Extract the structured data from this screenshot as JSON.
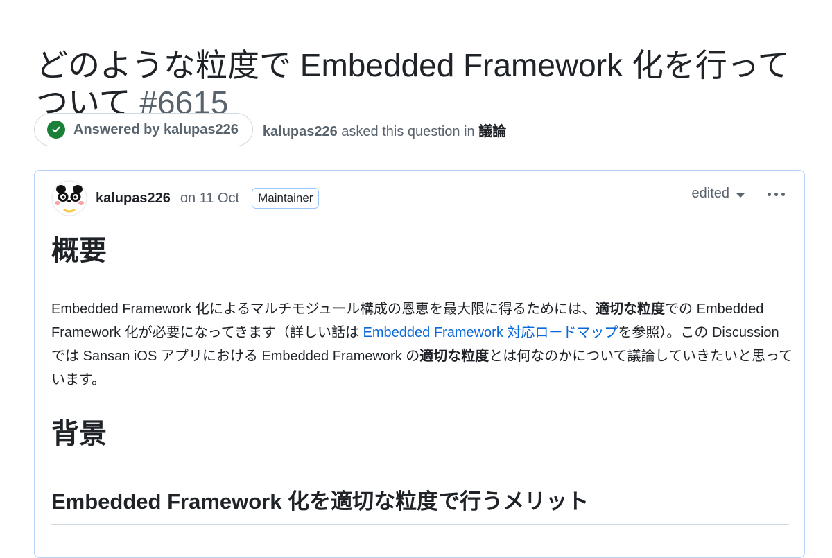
{
  "discussion": {
    "title_line1": "どのような粒度で Embedded Framework 化を行って",
    "title_line2": "ついて",
    "number": "#6615",
    "answered_label": "Answered by kalupas226",
    "asker": "kalupas226",
    "asked_text": " asked this question in ",
    "category": "議論"
  },
  "post": {
    "author": "kalupas226",
    "date": "on 11 Oct",
    "badge": "Maintainer",
    "edited_label": "edited",
    "heading_overview": "概要",
    "para": {
      "t1": "Embedded Framework 化によるマルチモジュール構成の恩恵を最大限に得るためには、",
      "b1": "適切な粒度",
      "t2": "での Embedded Framework 化が必要になってきます（詳しい話は ",
      "link": "Embedded Framework 対応ロードマップ",
      "t3": "を参照）。この Discussion では Sansan iOS アプリにおける Embedded Framework の",
      "b2": "適切な粒度",
      "t4": "とは何なのかについて議論していきたいと思っています。"
    },
    "heading_background": "背景",
    "heading_merit": "Embedded Framework 化を適切な粒度で行うメリット"
  },
  "colors": {
    "success": "#1a7f37",
    "link": "#0969da",
    "muted": "#59636e",
    "card_border": "#b6d4f7"
  },
  "icons": [
    "check-circle-icon",
    "avatar-panda-icon",
    "caret-down-icon",
    "kebab-menu-icon"
  ]
}
